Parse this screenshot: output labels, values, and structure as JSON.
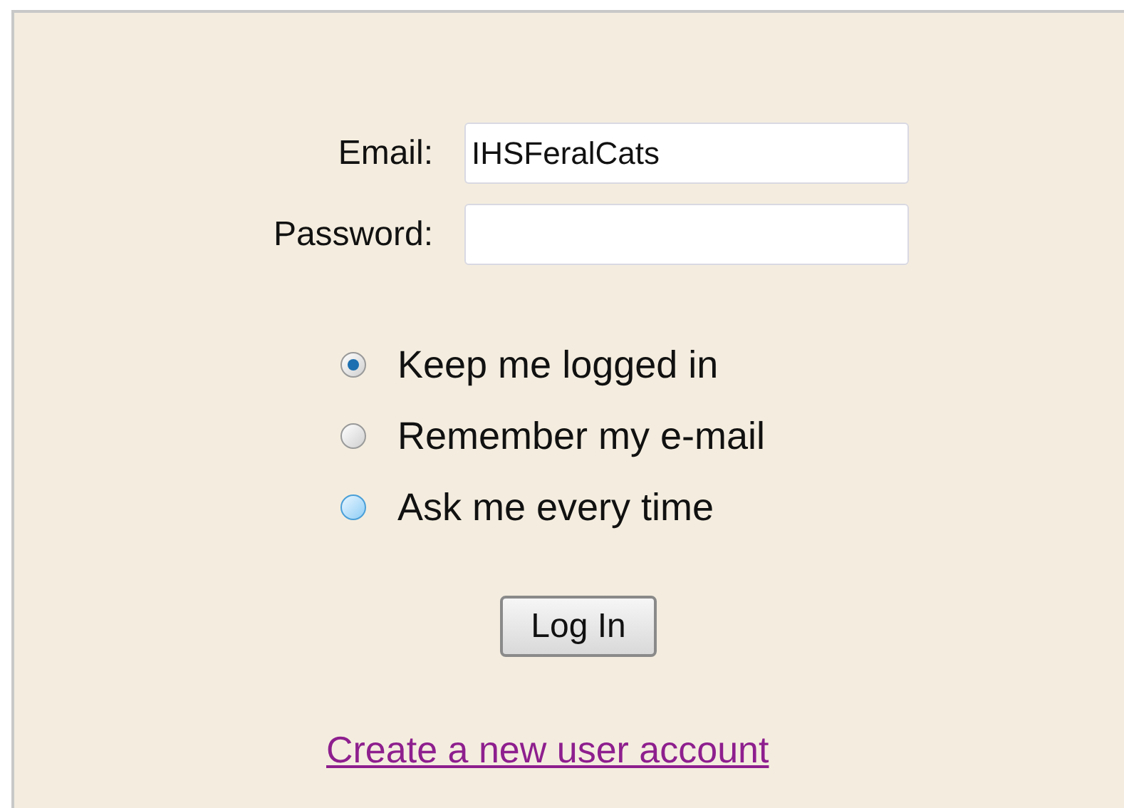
{
  "form": {
    "fields": [
      {
        "label": "Email:",
        "value": "IHSFeralCats"
      },
      {
        "label": "Password:"
      }
    ],
    "options": [
      {
        "label": "Keep me logged in",
        "selected": true,
        "hovered": false
      },
      {
        "label": "Remember my e-mail",
        "selected": false,
        "hovered": false
      },
      {
        "label": "Ask me every time",
        "selected": false,
        "hovered": true
      }
    ],
    "button": "Log In",
    "link": "Create a new user account"
  }
}
